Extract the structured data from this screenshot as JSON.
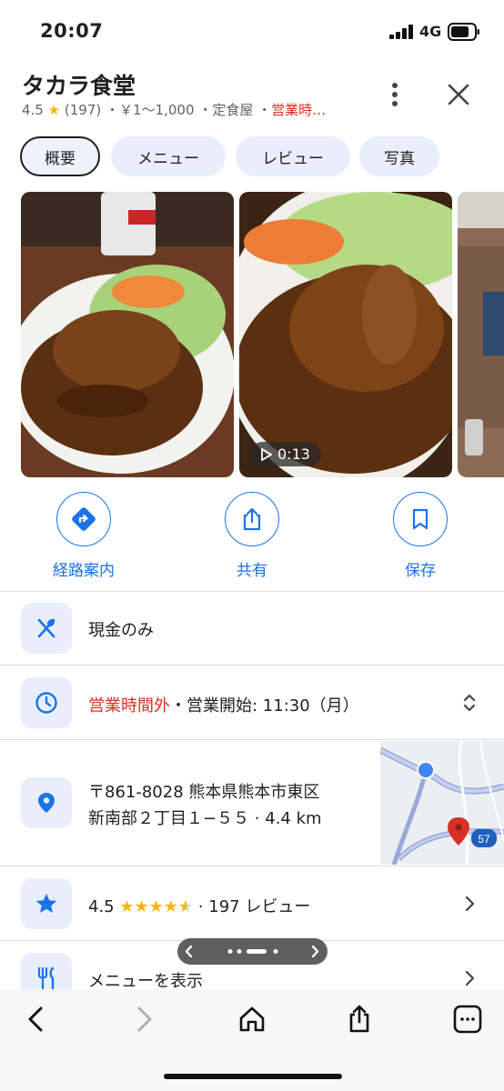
{
  "status_bar": {
    "time": "20:07",
    "network": "4G"
  },
  "place": {
    "name": "タカラ食堂",
    "rating": "4.5",
    "review_count": "(197)",
    "price": "￥1〜1,000",
    "category": "定食屋",
    "open_status_short": "営業時…",
    "separator": "・"
  },
  "tabs": [
    {
      "label": "概要",
      "active": true
    },
    {
      "label": "メニュー",
      "active": false
    },
    {
      "label": "レビュー",
      "active": false
    },
    {
      "label": "写真",
      "active": false
    }
  ],
  "photos": {
    "video_duration": "0:13"
  },
  "actions": [
    {
      "label": "経路案内",
      "icon": "directions-icon"
    },
    {
      "label": "共有",
      "icon": "share-icon"
    },
    {
      "label": "保存",
      "icon": "bookmark-icon"
    }
  ],
  "info": {
    "payment": "現金のみ",
    "hours_status": "営業時間外",
    "hours_next": "・営業開始: 11:30（月）",
    "address_line1": "〒861-8028 熊本県熊本市東区",
    "address_line2": "新南部２丁目１−５５ · 4.4 km",
    "rating_value": "4.5",
    "rating_stars": "★★★★",
    "rating_reviews": "· 197 レビュー",
    "menu_label": "メニューを表示",
    "map_route_number": "57"
  },
  "colors": {
    "accent": "#1a73e8",
    "closed": "#d93025",
    "star": "#f6b40e",
    "chip_bg": "#e8eefb"
  }
}
